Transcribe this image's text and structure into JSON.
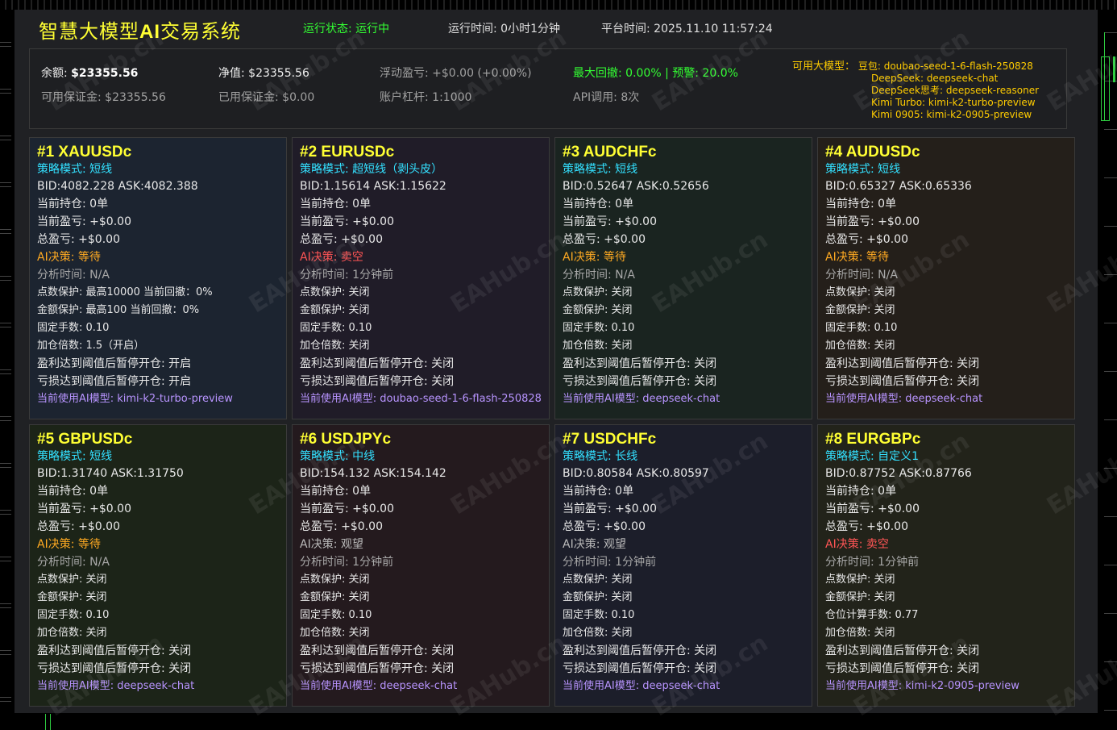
{
  "header": {
    "title_prefix": "智慧大模型",
    "title_ai": "AI",
    "title_suffix": "交易系统",
    "status": "运行状态: 运行中",
    "runtime": "运行时间: 0小时1分钟",
    "platform_time": "平台时间: 2025.11.10 11:57:24"
  },
  "account": {
    "balance_label": "余额: ",
    "balance_value": "$23355.56",
    "equity": "净值: $23355.56",
    "floating_pnl": "浮动盈亏: +$0.00 (+0.00%)",
    "max_drawdown": "最大回撤: 0.00% | 预警: 20.0%",
    "free_margin": "可用保证金: $23355.56",
    "used_margin": "已用保证金: $0.00",
    "leverage": "账户杠杆: 1:1000",
    "api_calls": "API调用: 8次",
    "models_label": "可用大模型：",
    "models": [
      "豆包: doubao-seed-1-6-flash-250828",
      "DeepSeek: deepseek-chat",
      "DeepSeek思考: deepseek-reasoner",
      "Kimi Turbo: kimi-k2-turbo-preview",
      "Kimi 0905: kimi-k2-0905-preview"
    ]
  },
  "watermark": "EAHub.cn",
  "colors": {
    "title": "#ffff33",
    "status_green": "#33ff33",
    "mode_cyan": "#33e0ff",
    "decision_wait": "#ffaa22",
    "decision_sell": "#ff5555",
    "model_purple": "#b894ff",
    "models_gold": "#ffcc00"
  },
  "cards": [
    {
      "symbol": "#1 XAUUSDc",
      "mode": "策略模式: 短线",
      "bidask": "BID:4082.228 ASK:4082.388",
      "position": "当前持仓: 0单",
      "current_pnl": "当前盈亏: +$0.00",
      "total_pnl": "总盈亏: +$0.00",
      "decision": "AI决策: 等待",
      "analysis_time": "分析时间: N/A",
      "point_protect": "点数保护: 最高10000 当前回撤：0%",
      "amount_protect": "金额保护: 最高100 当前回撤：0%",
      "lots": "固定手数: 0.10",
      "add_mult": "加仓倍数: 1.5（开启）",
      "profit_pause": "盈利达到阈值后暂停开仓: 开启",
      "loss_pause": "亏损达到阈值后暂停开仓: 开启",
      "model": "当前使用AI模型: kimi-k2-turbo-preview"
    },
    {
      "symbol": "#2 EURUSDc",
      "mode": "策略模式: 超短线（剥头皮）",
      "bidask": "BID:1.15614 ASK:1.15622",
      "position": "当前持仓: 0单",
      "current_pnl": "当前盈亏: +$0.00",
      "total_pnl": "总盈亏: +$0.00",
      "decision": "AI决策: 卖空",
      "analysis_time": "分析时间: 1分钟前",
      "point_protect": "点数保护: 关闭",
      "amount_protect": "金额保护: 关闭",
      "lots": "固定手数: 0.10",
      "add_mult": "加仓倍数: 关闭",
      "profit_pause": "盈利达到阈值后暂停开仓: 关闭",
      "loss_pause": "亏损达到阈值后暂停开仓: 关闭",
      "model": "当前使用AI模型: doubao-seed-1-6-flash-250828"
    },
    {
      "symbol": "#3 AUDCHFc",
      "mode": "策略模式: 短线",
      "bidask": "BID:0.52647 ASK:0.52656",
      "position": "当前持仓: 0单",
      "current_pnl": "当前盈亏: +$0.00",
      "total_pnl": "总盈亏: +$0.00",
      "decision": "AI决策: 等待",
      "analysis_time": "分析时间: N/A",
      "point_protect": "点数保护: 关闭",
      "amount_protect": "金额保护: 关闭",
      "lots": "固定手数: 0.10",
      "add_mult": "加仓倍数: 关闭",
      "profit_pause": "盈利达到阈值后暂停开仓: 关闭",
      "loss_pause": "亏损达到阈值后暂停开仓: 关闭",
      "model": "当前使用AI模型: deepseek-chat"
    },
    {
      "symbol": "#4 AUDUSDc",
      "mode": "策略模式: 短线",
      "bidask": "BID:0.65327 ASK:0.65336",
      "position": "当前持仓: 0单",
      "current_pnl": "当前盈亏: +$0.00",
      "total_pnl": "总盈亏: +$0.00",
      "decision": "AI决策: 等待",
      "analysis_time": "分析时间: N/A",
      "point_protect": "点数保护: 关闭",
      "amount_protect": "金额保护: 关闭",
      "lots": "固定手数: 0.10",
      "add_mult": "加仓倍数: 关闭",
      "profit_pause": "盈利达到阈值后暂停开仓: 关闭",
      "loss_pause": "亏损达到阈值后暂停开仓: 关闭",
      "model": "当前使用AI模型: deepseek-chat"
    },
    {
      "symbol": "#5 GBPUSDc",
      "mode": "策略模式: 短线",
      "bidask": "BID:1.31740 ASK:1.31750",
      "position": "当前持仓: 0单",
      "current_pnl": "当前盈亏: +$0.00",
      "total_pnl": "总盈亏: +$0.00",
      "decision": "AI决策: 等待",
      "analysis_time": "分析时间: N/A",
      "point_protect": "点数保护: 关闭",
      "amount_protect": "金额保护: 关闭",
      "lots": "固定手数: 0.10",
      "add_mult": "加仓倍数: 关闭",
      "profit_pause": "盈利达到阈值后暂停开仓: 关闭",
      "loss_pause": "亏损达到阈值后暂停开仓: 关闭",
      "model": "当前使用AI模型: deepseek-chat"
    },
    {
      "symbol": "#6 USDJPYc",
      "mode": "策略模式: 中线",
      "bidask": "BID:154.132 ASK:154.142",
      "position": "当前持仓: 0单",
      "current_pnl": "当前盈亏: +$0.00",
      "total_pnl": "总盈亏: +$0.00",
      "decision": "AI决策: 观望",
      "analysis_time": "分析时间: 1分钟前",
      "point_protect": "点数保护: 关闭",
      "amount_protect": "金额保护: 关闭",
      "lots": "固定手数: 0.10",
      "add_mult": "加仓倍数: 关闭",
      "profit_pause": "盈利达到阈值后暂停开仓: 关闭",
      "loss_pause": "亏损达到阈值后暂停开仓: 关闭",
      "model": "当前使用AI模型: deepseek-chat"
    },
    {
      "symbol": "#7 USDCHFc",
      "mode": "策略模式: 长线",
      "bidask": "BID:0.80584 ASK:0.80597",
      "position": "当前持仓: 0单",
      "current_pnl": "当前盈亏: +$0.00",
      "total_pnl": "总盈亏: +$0.00",
      "decision": "AI决策: 观望",
      "analysis_time": "分析时间: 1分钟前",
      "point_protect": "点数保护: 关闭",
      "amount_protect": "金额保护: 关闭",
      "lots": "固定手数: 0.10",
      "add_mult": "加仓倍数: 关闭",
      "profit_pause": "盈利达到阈值后暂停开仓: 关闭",
      "loss_pause": "亏损达到阈值后暂停开仓: 关闭",
      "model": "当前使用AI模型: deepseek-chat"
    },
    {
      "symbol": "#8 EURGBPc",
      "mode": "策略模式: 自定义1",
      "bidask": "BID:0.87752 ASK:0.87766",
      "position": "当前持仓: 0单",
      "current_pnl": "当前盈亏: +$0.00",
      "total_pnl": "总盈亏: +$0.00",
      "decision": "AI决策: 卖空",
      "analysis_time": "分析时间: 1分钟前",
      "point_protect": "点数保护: 关闭",
      "amount_protect": "金额保护: 关闭",
      "lots": "仓位计算手数: 0.77",
      "add_mult": "加仓倍数: 关闭",
      "profit_pause": "盈利达到阈值后暂停开仓: 关闭",
      "loss_pause": "亏损达到阈值后暂停开仓: 关闭",
      "model": "当前使用AI模型: kimi-k2-0905-preview"
    }
  ]
}
